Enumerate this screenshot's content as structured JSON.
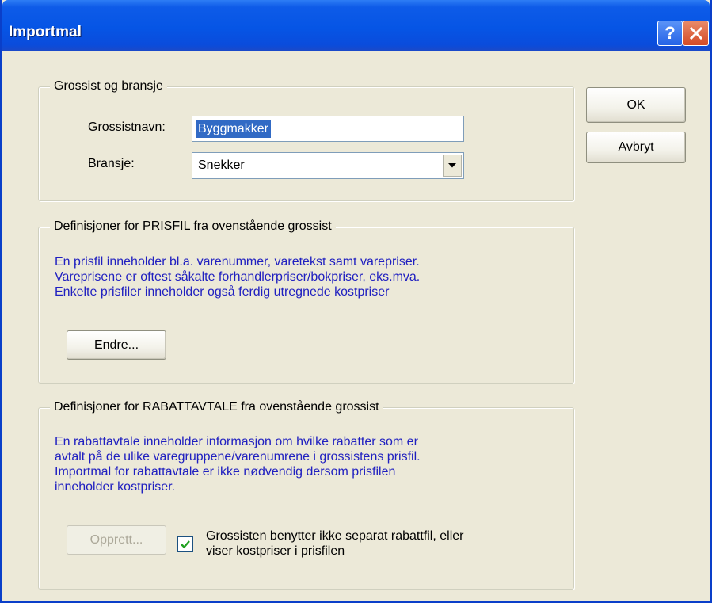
{
  "window": {
    "title": "Importmal",
    "help_label": "?",
    "close_icon": "close-icon"
  },
  "actions": {
    "ok_label": "OK",
    "cancel_label": "Avbryt"
  },
  "wholesaler_group": {
    "title": "Grossist og bransje",
    "name_label": "Grossistnavn:",
    "name_value": "Byggmakker",
    "industry_label": "Bransje:",
    "industry_value": "Snekker"
  },
  "pricefile_group": {
    "title": "Definisjoner for PRISFIL fra ovenstående grossist",
    "info": [
      "En prisfil inneholder bl.a. varenummer, varetekst samt varepriser.",
      "Vareprisene er oftest såkalte forhandlerpriser/bokpriser, eks.mva.",
      "Enkelte prisfiler inneholder også ferdig utregnede kostpriser"
    ],
    "change_button": "Endre..."
  },
  "discount_group": {
    "title": "Definisjoner for RABATTAVTALE fra ovenstående grossist",
    "info": [
      "En rabattavtale inneholder informasjon om hvilke rabatter som er",
      "avtalt på de ulike varegruppene/varenumrene i grossistens prisfil.",
      "Importmal for rabattavtale er ikke nødvendig dersom prisfilen",
      "inneholder kostpriser."
    ],
    "create_button": "Opprett...",
    "checkbox_checked": true,
    "checkbox_label": [
      "Grossisten benytter ikke separat rabattfil, eller",
      "viser kostpriser i prisfilen"
    ]
  }
}
